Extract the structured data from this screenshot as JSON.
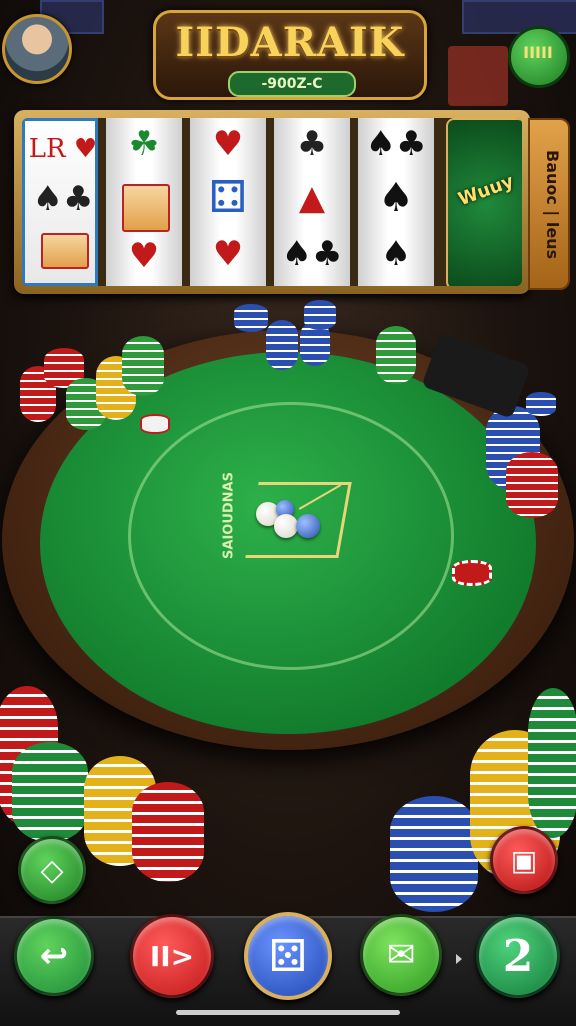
{
  "header": {
    "title": "IIDARAIK",
    "subtitle": "-900Z-C",
    "menu_glyph": "IIIII"
  },
  "slot": {
    "side_tab_text": "Bauoc | leus",
    "bonus_symbol_text": "Wuuy",
    "reel_symbols": [
      [
        "LR ♥",
        "♠♣",
        "♦"
      ],
      [
        "☘",
        "⚠",
        "♥"
      ],
      [
        "♥",
        "⚃",
        "♥"
      ],
      [
        "♣",
        "▲",
        "♠♣"
      ],
      [
        "♠♣",
        "♠",
        "♠"
      ]
    ]
  },
  "table": {
    "center_label": "SAIOUDNAS",
    "colors": {
      "felt": "#1e9a3c",
      "rim": "#5a3418",
      "line": "#e6d77a"
    }
  },
  "controls": {
    "left_small_icon": "diamond-arrow-icon",
    "right_small_icon": "frame-icon",
    "buttons": [
      {
        "icon": "back-arrow-icon",
        "glyph": "↩",
        "color": "#1e9a3c"
      },
      {
        "icon": "play-forward-icon",
        "glyph": "II>",
        "color": "#d42424"
      },
      {
        "icon": "dice-icon",
        "glyph": "⚄",
        "color": "#2a5fc2"
      },
      {
        "icon": "message-icon",
        "glyph": "✉",
        "color": "#3ab52c"
      },
      {
        "icon": "number-badge-icon",
        "glyph": "2",
        "color": "#1a9a48"
      }
    ]
  }
}
